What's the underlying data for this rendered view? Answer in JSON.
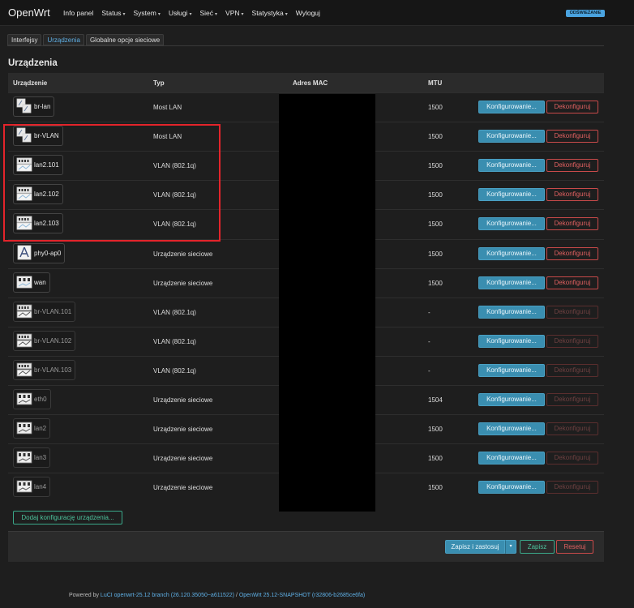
{
  "app": {
    "brand": "OpenWrt",
    "refresh_label": "ODŚWIEŻANIE"
  },
  "menu": [
    {
      "label": "Info panel",
      "dropdown": false
    },
    {
      "label": "Status",
      "dropdown": true
    },
    {
      "label": "System",
      "dropdown": true
    },
    {
      "label": "Usługi",
      "dropdown": true
    },
    {
      "label": "Sieć",
      "dropdown": true
    },
    {
      "label": "VPN",
      "dropdown": true
    },
    {
      "label": "Statystyka",
      "dropdown": true
    },
    {
      "label": "Wyloguj",
      "dropdown": false
    }
  ],
  "tabs": [
    {
      "label": "Interfejsy",
      "active": false
    },
    {
      "label": "Urządzenia",
      "active": true
    },
    {
      "label": "Globalne opcje sieciowe",
      "active": false
    }
  ],
  "section_title": "Urządzenia",
  "table": {
    "headers": {
      "device": "Urządzenie",
      "type": "Typ",
      "mac": "Adres MAC",
      "mtu": "MTU"
    },
    "configure_label": "Konfigurowanie...",
    "deconfigure_label": "Dekonfiguruj",
    "rows": [
      {
        "name": "br-lan",
        "type": "Most LAN",
        "mtu": "1500",
        "icon": "bridge-icon",
        "dim": false,
        "deconf_enabled": true
      },
      {
        "name": "br-VLAN",
        "type": "Most LAN",
        "mtu": "1500",
        "icon": "bridge-icon",
        "dim": false,
        "deconf_enabled": true
      },
      {
        "name": "lan2.101",
        "type": "VLAN (802.1q)",
        "mtu": "1500",
        "icon": "vlan-icon",
        "dim": false,
        "deconf_enabled": true
      },
      {
        "name": "lan2.102",
        "type": "VLAN (802.1q)",
        "mtu": "1500",
        "icon": "vlan-icon",
        "dim": false,
        "deconf_enabled": true
      },
      {
        "name": "lan2.103",
        "type": "VLAN (802.1q)",
        "mtu": "1500",
        "icon": "vlan-icon",
        "dim": false,
        "deconf_enabled": true
      },
      {
        "name": "phy0-ap0",
        "type": "Urządzenie sieciowe",
        "mtu": "1500",
        "icon": "wireless-icon",
        "dim": false,
        "deconf_enabled": true
      },
      {
        "name": "wan",
        "type": "Urządzenie sieciowe",
        "mtu": "1500",
        "icon": "ethernet-icon",
        "dim": false,
        "deconf_enabled": true
      },
      {
        "name": "br-VLAN.101",
        "type": "VLAN (802.1q)",
        "mtu": "-",
        "icon": "vlan-icon",
        "dim": true,
        "deconf_enabled": false
      },
      {
        "name": "br-VLAN.102",
        "type": "VLAN (802.1q)",
        "mtu": "-",
        "icon": "vlan-icon",
        "dim": true,
        "deconf_enabled": false
      },
      {
        "name": "br-VLAN.103",
        "type": "VLAN (802.1q)",
        "mtu": "-",
        "icon": "vlan-icon",
        "dim": true,
        "deconf_enabled": false
      },
      {
        "name": "eth0",
        "type": "Urządzenie sieciowe",
        "mtu": "1504",
        "icon": "ethernet-icon",
        "dim": true,
        "deconf_enabled": false
      },
      {
        "name": "lan2",
        "type": "Urządzenie sieciowe",
        "mtu": "1500",
        "icon": "ethernet-icon",
        "dim": true,
        "deconf_enabled": false
      },
      {
        "name": "lan3",
        "type": "Urządzenie sieciowe",
        "mtu": "1500",
        "icon": "ethernet-icon",
        "dim": true,
        "deconf_enabled": false
      },
      {
        "name": "lan4",
        "type": "Urządzenie sieciowe",
        "mtu": "1500",
        "icon": "ethernet-icon",
        "dim": true,
        "deconf_enabled": false
      }
    ]
  },
  "add_device_label": "Dodaj konfigurację urządzenia...",
  "actions": {
    "save_apply": "Zapisz i zastosuj",
    "save": "Zapisz",
    "reset": "Resetuj"
  },
  "footer": {
    "prefix": "Powered by ",
    "luci": "LuCI openwrt-25.12 branch (26.120.35050~a611522)",
    "sep": " / ",
    "openwrt": "OpenWrt 25.12-SNAPSHOT (r32806-b2685ce6fa)"
  },
  "colors": {
    "accent": "#3a8eb0",
    "danger": "#e06060",
    "success": "#4dc39d",
    "highlight": "#e3242b"
  }
}
